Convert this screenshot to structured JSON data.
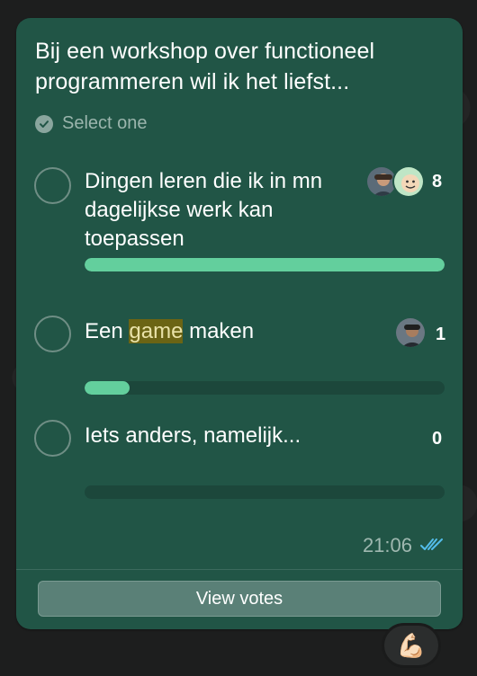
{
  "poll": {
    "question": "Bij een workshop over functioneel programmeren wil ik het liefst...",
    "instruction": "Select one",
    "options": [
      {
        "label": "Dingen leren die ik in mn dagelijkse werk kan toepassen",
        "count": "8",
        "vote_fraction": 1.0
      },
      {
        "label_before": "Een ",
        "label_highlight": "game",
        "label_after": " maken",
        "count": "1",
        "vote_fraction": 0.125
      },
      {
        "label": "Iets anders, namelijk...",
        "count": "0",
        "vote_fraction": 0
      }
    ],
    "timestamp": "21:06",
    "view_votes_label": "View votes"
  },
  "reaction": {
    "emoji": "💪🏻"
  },
  "colors": {
    "bubble": "#215546",
    "bar_fill": "#63cf9d",
    "bar_track": "#1c473b",
    "read_receipt": "#53bdeb",
    "highlight": "#6b6414"
  }
}
